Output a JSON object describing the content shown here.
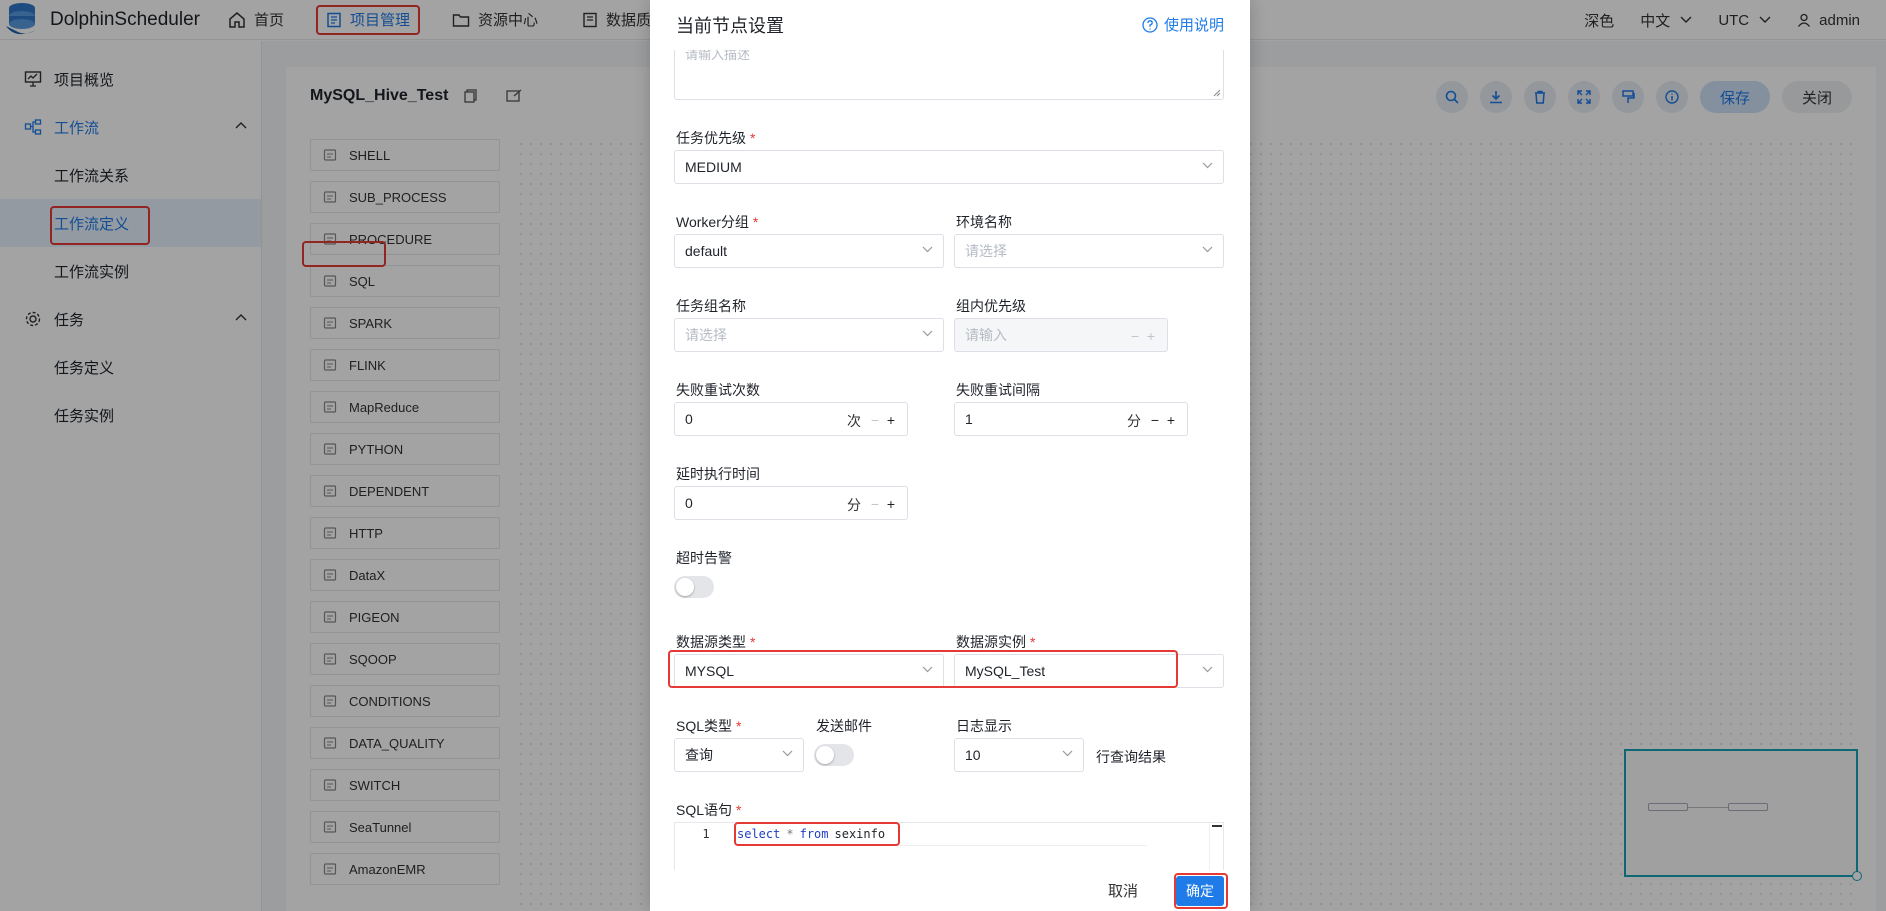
{
  "app": {
    "name": "DolphinScheduler"
  },
  "topnav": {
    "items": [
      {
        "label": "首页",
        "icon": "home-icon"
      },
      {
        "label": "项目管理",
        "icon": "project-icon",
        "active": true
      },
      {
        "label": "资源中心",
        "icon": "folder-icon"
      },
      {
        "label": "数据质量",
        "icon": "data-quality-icon"
      }
    ],
    "theme_label": "深色",
    "language": "中文",
    "timezone": "UTC",
    "user": "admin"
  },
  "sidebar": {
    "overview": "项目概览",
    "workflow_group": "工作流",
    "workflow_items": [
      "工作流关系",
      "工作流定义",
      "工作流实例"
    ],
    "task_group": "任务",
    "task_items": [
      "任务定义",
      "任务实例"
    ]
  },
  "workflow": {
    "name": "MySQL_Hive_Test",
    "save_label": "保存",
    "close_label": "关闭",
    "task_types": [
      "SHELL",
      "SUB_PROCESS",
      "PROCEDURE",
      "SQL",
      "SPARK",
      "FLINK",
      "MapReduce",
      "PYTHON",
      "DEPENDENT",
      "HTTP",
      "DataX",
      "PIGEON",
      "SQOOP",
      "CONDITIONS",
      "DATA_QUALITY",
      "SWITCH",
      "SeaTunnel",
      "AmazonEMR"
    ]
  },
  "modal": {
    "title": "当前节点设置",
    "help": "使用说明",
    "description_placeholder": "请输入描述",
    "priority": {
      "label": "任务优先级",
      "value": "MEDIUM"
    },
    "worker_group": {
      "label": "Worker分组",
      "value": "default"
    },
    "environment": {
      "label": "环境名称",
      "placeholder": "请选择"
    },
    "task_group": {
      "label": "任务组名称",
      "placeholder": "请选择"
    },
    "group_priority": {
      "label": "组内优先级",
      "placeholder": "请输入"
    },
    "retry_times": {
      "label": "失败重试次数",
      "value": "0",
      "unit": "次"
    },
    "retry_interval": {
      "label": "失败重试间隔",
      "value": "1",
      "unit": "分"
    },
    "delay_time": {
      "label": "延时执行时间",
      "value": "0",
      "unit": "分"
    },
    "timeout_alarm": {
      "label": "超时告警",
      "enabled": false
    },
    "datasource_type": {
      "label": "数据源类型",
      "value": "MYSQL"
    },
    "datasource_instance": {
      "label": "数据源实例",
      "value": "MySQL_Test"
    },
    "sql_type": {
      "label": "SQL类型",
      "value": "查询"
    },
    "send_email": {
      "label": "发送邮件",
      "enabled": false
    },
    "log_display": {
      "label": "日志显示",
      "value": "10",
      "suffix": "行查询结果"
    },
    "sql_statement": {
      "label": "SQL语句",
      "line_number": "1",
      "tokens": {
        "select": "select",
        "star": "*",
        "from": "from",
        "table": "sexinfo"
      }
    },
    "cancel_label": "取消",
    "confirm_label": "确定"
  }
}
